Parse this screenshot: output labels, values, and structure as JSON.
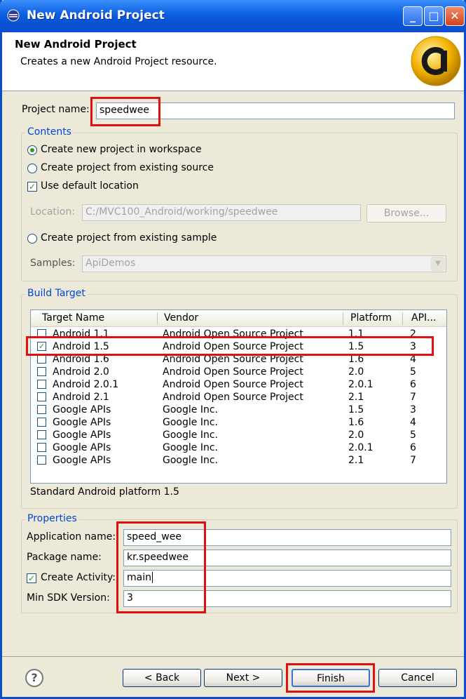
{
  "window": {
    "title": "New Android Project"
  },
  "header": {
    "title": "New Android Project",
    "description": "Creates a new Android Project resource."
  },
  "project": {
    "label": "Project name:",
    "value": "speedwee"
  },
  "contents": {
    "title": "Contents",
    "options": [
      "Create new project in workspace",
      "Create project from existing source"
    ],
    "use_default_label": "Use default location",
    "location_label": "Location:",
    "location_value": "C:/MVC100_Android/working/speedwee",
    "browse_label": "Browse...",
    "sample_option": "Create project from existing sample",
    "samples_label": "Samples:",
    "samples_value": "ApiDemos"
  },
  "build_target": {
    "title": "Build Target",
    "columns": [
      "Target Name",
      "Vendor",
      "Platform",
      "API..."
    ],
    "rows": [
      {
        "checked": false,
        "name": "Android 1.1",
        "vendor": "Android Open Source Project",
        "platform": "1.1",
        "api": "2"
      },
      {
        "checked": true,
        "name": "Android 1.5",
        "vendor": "Android Open Source Project",
        "platform": "1.5",
        "api": "3"
      },
      {
        "checked": false,
        "name": "Android 1.6",
        "vendor": "Android Open Source Project",
        "platform": "1.6",
        "api": "4"
      },
      {
        "checked": false,
        "name": "Android 2.0",
        "vendor": "Android Open Source Project",
        "platform": "2.0",
        "api": "5"
      },
      {
        "checked": false,
        "name": "Android 2.0.1",
        "vendor": "Android Open Source Project",
        "platform": "2.0.1",
        "api": "6"
      },
      {
        "checked": false,
        "name": "Android 2.1",
        "vendor": "Android Open Source Project",
        "platform": "2.1",
        "api": "7"
      },
      {
        "checked": false,
        "name": "Google APIs",
        "vendor": "Google Inc.",
        "platform": "1.5",
        "api": "3"
      },
      {
        "checked": false,
        "name": "Google APIs",
        "vendor": "Google Inc.",
        "platform": "1.6",
        "api": "4"
      },
      {
        "checked": false,
        "name": "Google APIs",
        "vendor": "Google Inc.",
        "platform": "2.0",
        "api": "5"
      },
      {
        "checked": false,
        "name": "Google APIs",
        "vendor": "Google Inc.",
        "platform": "2.0.1",
        "api": "6"
      },
      {
        "checked": false,
        "name": "Google APIs",
        "vendor": "Google Inc.",
        "platform": "2.1",
        "api": "7"
      }
    ],
    "status": "Standard Android platform 1.5"
  },
  "properties": {
    "title": "Properties",
    "app_name_label": "Application name:",
    "app_name_value": "speed_wee",
    "package_label": "Package name:",
    "package_value": "kr.speedwee",
    "create_activity_label": "Create Activity:",
    "create_activity_value": "main",
    "min_sdk_label": "Min SDK Version:",
    "min_sdk_value": "3"
  },
  "buttons": {
    "back": "< Back",
    "next": "Next >",
    "finish": "Finish",
    "cancel": "Cancel"
  },
  "colors": {
    "highlight_box": "#e01010",
    "group_title": "#0046d5"
  }
}
